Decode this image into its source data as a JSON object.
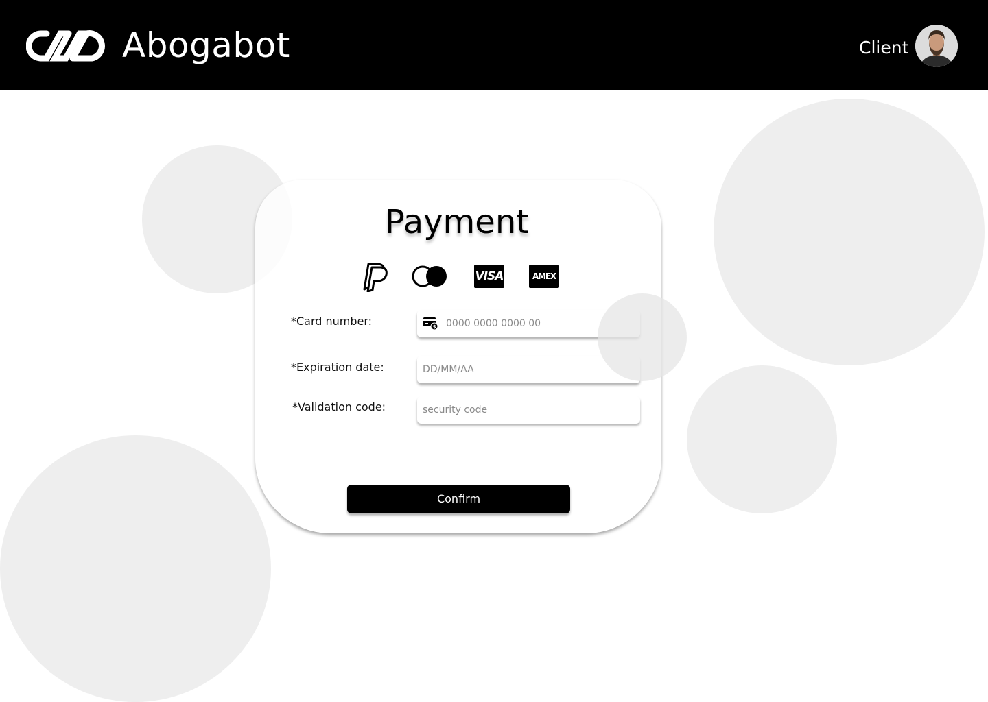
{
  "header": {
    "brand_name": "Abogabot",
    "user_role": "Client",
    "logo_icon": "infinity-chain-logo",
    "avatar_icon": "user-avatar"
  },
  "payment": {
    "title": "Payment",
    "methods": [
      {
        "name": "PayPal",
        "icon": "paypal-icon"
      },
      {
        "name": "Mastercard",
        "icon": "mastercard-icon"
      },
      {
        "name": "Visa",
        "icon": "visa-icon",
        "text": "VISA"
      },
      {
        "name": "American Express",
        "icon": "amex-icon",
        "text": "AMEX"
      }
    ],
    "fields": {
      "card_number": {
        "label": "*Card number:",
        "placeholder": "0000 0000 0000 00",
        "value": "",
        "icon": "credit-card-dollar-icon"
      },
      "expiration": {
        "label": "*Expiration date:",
        "placeholder": "DD/MM/AA",
        "value": ""
      },
      "validation": {
        "label": "*Validation code:",
        "placeholder": "security code",
        "value": ""
      }
    },
    "confirm_label": "Confirm"
  },
  "colors": {
    "header_bg": "#000000",
    "page_bg": "#ffffff",
    "circle": "#eeeeee",
    "button_bg": "#000000",
    "button_text": "#ffffff"
  }
}
